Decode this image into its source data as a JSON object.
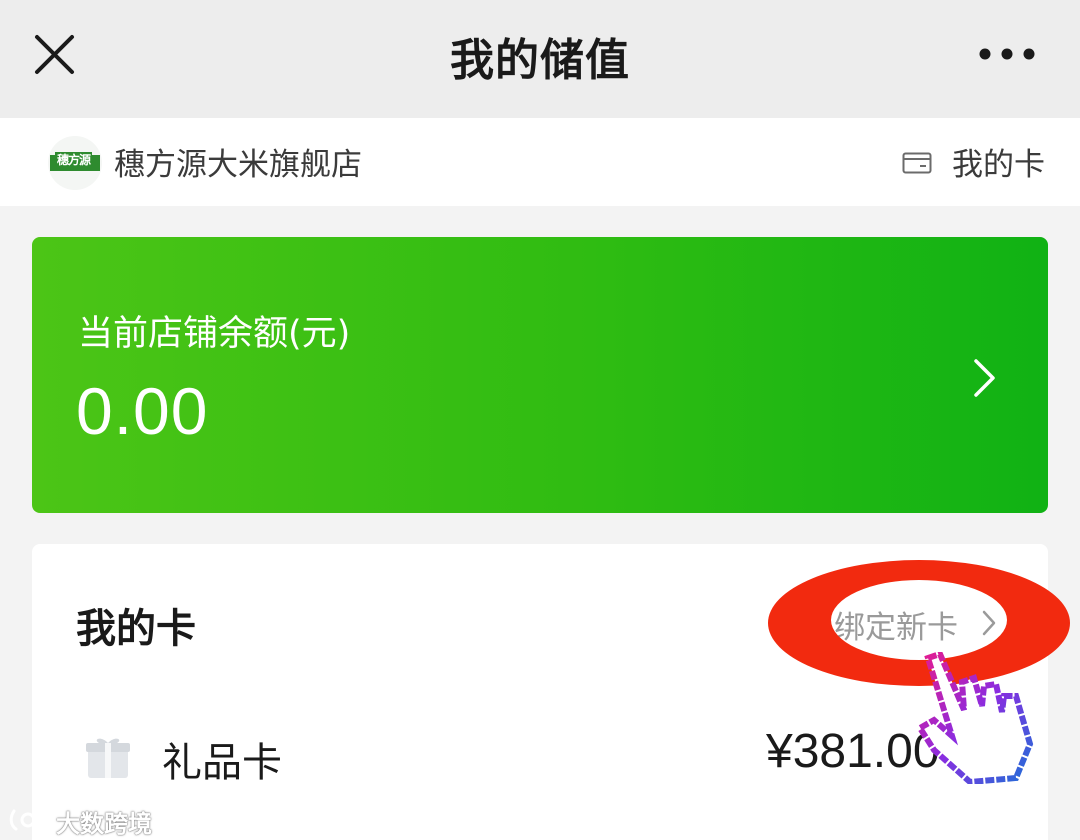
{
  "header": {
    "title": "我的储值",
    "close_icon": "close-icon",
    "more_icon": "more-icon"
  },
  "store": {
    "logo_text": "穗方源",
    "name": "穗方源大米旗舰店",
    "my_card_label": "我的卡",
    "card_icon": "card-icon"
  },
  "balance": {
    "label": "当前店铺余额(元)",
    "amount": "0.00",
    "gradient_start": "#4cc516",
    "gradient_end": "#10b214"
  },
  "cards": {
    "title": "我的卡",
    "bind_label": "绑定新卡",
    "items": [
      {
        "name": "礼品卡",
        "amount": "¥381.00",
        "icon": "gift-card-icon"
      }
    ]
  },
  "annotation": {
    "ellipse_color": "#f22a0f",
    "pointer_icon": "hand-pointer-icon"
  },
  "watermark": {
    "text": "大数跨境"
  }
}
